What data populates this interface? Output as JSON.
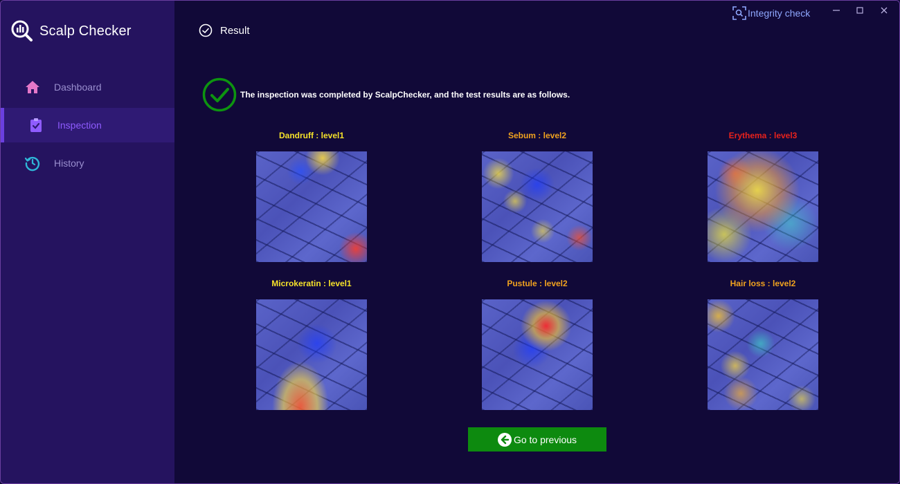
{
  "app": {
    "title": "Scalp Checker"
  },
  "sidebar": {
    "items": [
      {
        "label": "Dashboard",
        "icon": "home-icon",
        "color": "#e477c8"
      },
      {
        "label": "Inspection",
        "icon": "clipboard-check-icon",
        "color": "#8f5cff",
        "active": true
      },
      {
        "label": "History",
        "icon": "history-icon",
        "color": "#2fb6d8"
      }
    ]
  },
  "titlebar": {
    "integrity_label": "Integrity check"
  },
  "page": {
    "title": "Result",
    "notice": "The inspection was completed by ScalpChecker, and the test results are as follows."
  },
  "results": [
    {
      "label": "Dandruff : level1",
      "color": "#f5e12a"
    },
    {
      "label": "Sebum : level2",
      "color": "#f0a21f"
    },
    {
      "label": "Erythema : level3",
      "color": "#e8221c"
    },
    {
      "label": "Microkeratin : level1",
      "color": "#f5e12a"
    },
    {
      "label": "Pustule : level2",
      "color": "#f0a21f"
    },
    {
      "label": "Hair loss : level2",
      "color": "#f0a21f"
    }
  ],
  "actions": {
    "back_label": "Go to previous"
  },
  "colors": {
    "accent": "#8f5cff",
    "success": "#0d8a0f",
    "sidebar_bg": "#25135f",
    "main_bg": "#110938"
  }
}
